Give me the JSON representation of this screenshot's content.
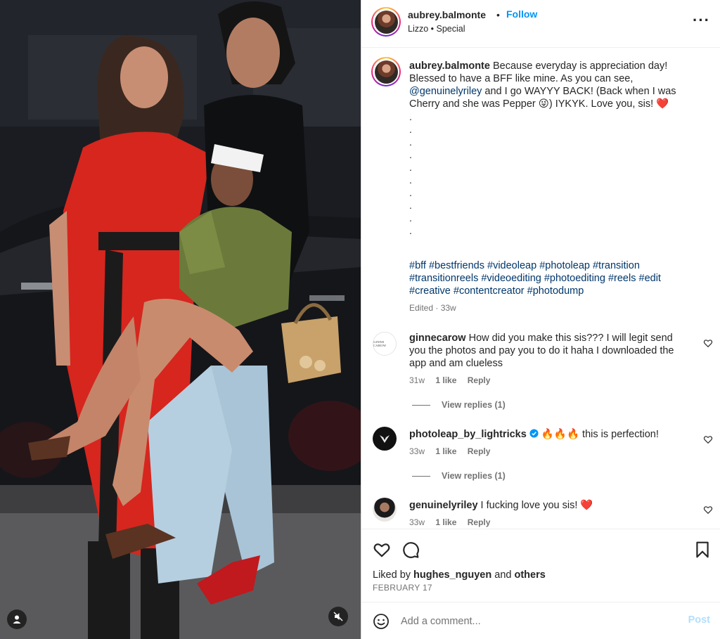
{
  "header": {
    "username": "aubrey.balmonte",
    "separator": "•",
    "follow_label": "Follow",
    "audio": "Lizzo • Special",
    "more_icon": "more-horizontal-icon"
  },
  "caption": {
    "username": "aubrey.balmonte",
    "text_part1": "Because everyday is appreciation day! Blessed to have a BFF like mine. As you can see,",
    "mention": "@genuinelyriley",
    "text_part2": "and I go WAYYY BACK! (Back when I was Cherry and she was Pepper 😜) IYKYK. Love you, sis! ❤️",
    "dots": [
      ".",
      ".",
      ".",
      ".",
      ".",
      ".",
      ".",
      ".",
      ".",
      "."
    ],
    "hashtags": [
      "#bff",
      "#bestfriends",
      "#videoleap",
      "#photoleap",
      "#transition",
      "#transitionreels",
      "#videoediting",
      "#photoediting",
      "#reels",
      "#edit",
      "#creative",
      "#contentcreator",
      "#photodump"
    ],
    "edited": "Edited",
    "time": "33w"
  },
  "comments": [
    {
      "username": "ginnecarow",
      "text": "How did you make this sis??? I will legit send you the photos and pay you to do it haha I downloaded the app and am clueless",
      "avatar_text": "GINNE CAROW",
      "time": "31w",
      "likes": "1 like",
      "reply": "Reply",
      "view_replies": "View replies (1)"
    },
    {
      "username": "photoleap_by_lightricks",
      "verified": true,
      "text": "🔥🔥🔥 this is perfection!",
      "time": "33w",
      "likes": "1 like",
      "reply": "Reply",
      "view_replies": "View replies (1)"
    },
    {
      "username": "genuinelyriley",
      "text": "I fucking love you sis! ❤️",
      "time": "33w",
      "likes": "1 like",
      "reply": "Reply"
    }
  ],
  "actions": {
    "like_icon": "heart-icon",
    "comment_icon": "comment-bubble-icon",
    "save_icon": "bookmark-icon",
    "liked_by_prefix": "Liked by",
    "liked_by_user": "hughes_nguyen",
    "liked_by_and": "and",
    "liked_by_others": "others",
    "date": "FEBRUARY 17"
  },
  "add_comment": {
    "placeholder": "Add a comment...",
    "post_label": "Post"
  },
  "colors": {
    "accent": "#0095f6",
    "link": "#00376b",
    "muted": "#737373",
    "like_red": "#ed4956",
    "post_disabled": "#b2dffc"
  }
}
